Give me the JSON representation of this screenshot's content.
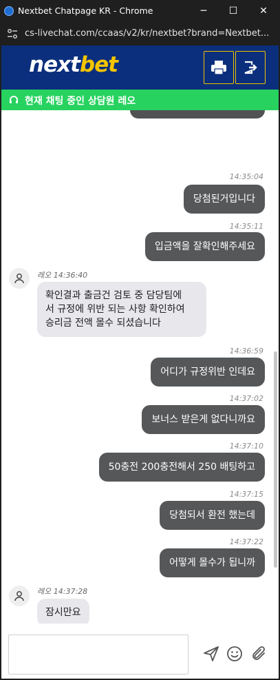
{
  "window": {
    "title": "Nextbet Chatpage KR - Chrome",
    "url": "cs-livechat.com/ccaas/v2/kr/nextbet?brand=Nextbet...",
    "controls": {
      "minimize": "─",
      "maximize": "☐",
      "close": "✕"
    }
  },
  "header": {
    "brand_part1": "next",
    "brand_part2": "bet",
    "print_icon": "printer-icon",
    "exit_icon": "exit-icon",
    "colors": {
      "bg": "#0b2f7c",
      "accent": "#f5c400"
    }
  },
  "status": {
    "text": "현재 채팅 중인 상담원 레오",
    "icon": "headset-icon",
    "color": "#27d25f"
  },
  "messages": [
    {
      "from": "user",
      "time": "14:35:04",
      "text": "당첨된거입니다"
    },
    {
      "from": "user",
      "time": "14:35:11",
      "text": "입금액을 잘확인해주세요"
    },
    {
      "from": "agent",
      "agent": "레오",
      "time": "14:36:40",
      "lines": [
        "확인결과 출금건 검토 중 담당팀에",
        "서 규정에 위반 되는 사항 확인하여",
        "승리금 전액 몰수 되셨습니다"
      ]
    },
    {
      "from": "user",
      "time": "14:36:59",
      "text": "어디가 규정위반 인데요"
    },
    {
      "from": "user",
      "time": "14:37:02",
      "text": "보너스 받은게 없다니까요"
    },
    {
      "from": "user",
      "time": "14:37:10",
      "text": "50충전 200충전해서 250 배팅하고"
    },
    {
      "from": "user",
      "time": "14:37:15",
      "text": "당첨되서 환전 했는데"
    },
    {
      "from": "user",
      "time": "14:37:22",
      "text": "어떻게 몰수가 됩니까"
    },
    {
      "from": "agent",
      "agent": "레오",
      "time": "14:37:28",
      "text": "잠시만요"
    }
  ],
  "composer": {
    "value": "",
    "send_icon": "send-icon",
    "emoji_icon": "emoji-icon",
    "attach_icon": "paperclip-icon"
  }
}
